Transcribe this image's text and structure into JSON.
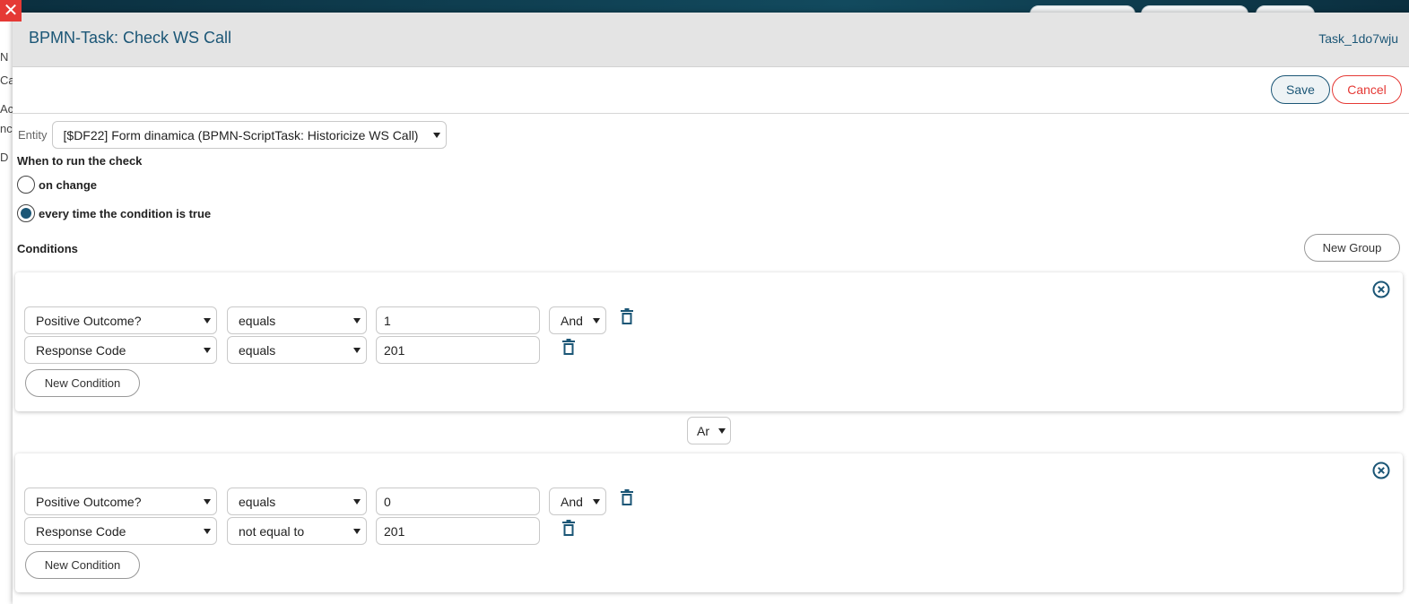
{
  "window": {
    "close_icon": "close-icon",
    "background_fragments": [
      "N",
      "Ca",
      "Ac",
      "nc",
      "D"
    ]
  },
  "modal": {
    "title": "BPMN-Task: Check WS Call",
    "task_id": "Task_1do7wju",
    "save_label": "Save",
    "cancel_label": "Cancel"
  },
  "entity": {
    "label": "Entity",
    "selected": "[$DF22] Form dinamica (BPMN-ScriptTask: Historicize WS Call)"
  },
  "when": {
    "label": "When to run the check",
    "options": [
      {
        "label": "on change",
        "checked": false
      },
      {
        "label": "every time the condition is true",
        "checked": true
      }
    ]
  },
  "conditions": {
    "label": "Conditions",
    "new_group_label": "New Group",
    "group_connector": "Ar",
    "groups": [
      {
        "rows": [
          {
            "field": "Positive Outcome?",
            "operator": "equals",
            "value": "1",
            "connector": "And"
          },
          {
            "field": "Response Code",
            "operator": "equals",
            "value": "201",
            "connector": ""
          }
        ],
        "new_condition_label": "New Condition"
      },
      {
        "rows": [
          {
            "field": "Positive Outcome?",
            "operator": "equals",
            "value": "0",
            "connector": "And"
          },
          {
            "field": "Response Code",
            "operator": "not equal to",
            "value": "201",
            "connector": ""
          }
        ],
        "new_condition_label": "New Condition"
      }
    ]
  },
  "colors": {
    "primary": "#1b5676",
    "danger": "#e53935",
    "header_bg": "#e4e4e4"
  }
}
